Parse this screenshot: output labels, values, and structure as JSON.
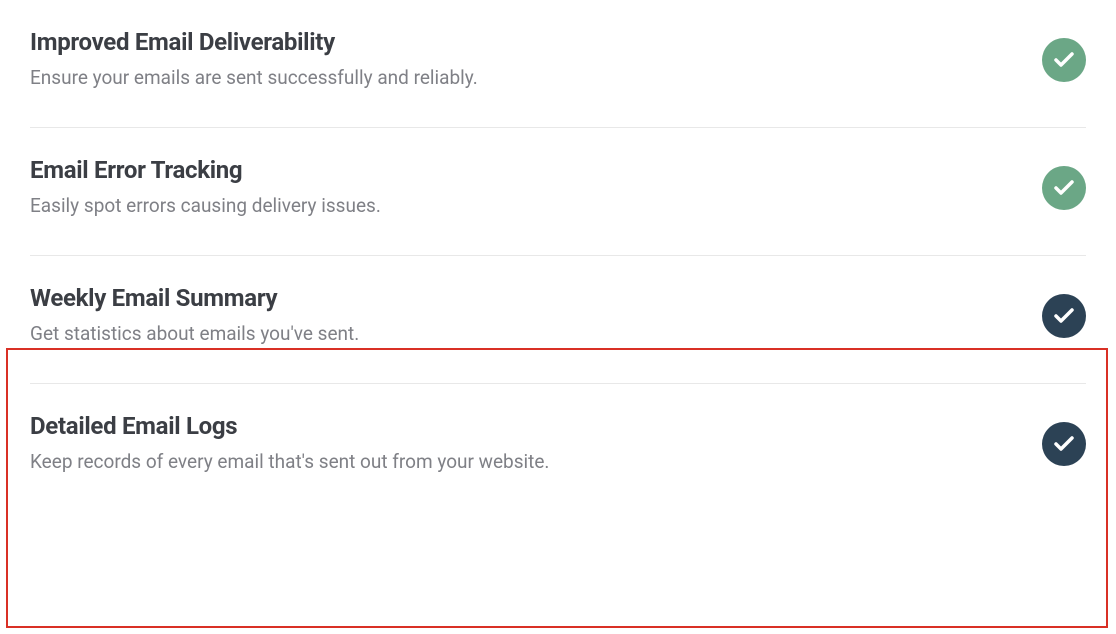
{
  "features": [
    {
      "title": "Improved Email Deliverability",
      "description": "Ensure your emails are sent successfully and reliably.",
      "badge_color": "green"
    },
    {
      "title": "Email Error Tracking",
      "description": "Easily spot errors causing delivery issues.",
      "badge_color": "green"
    },
    {
      "title": "Weekly Email Summary",
      "description": "Get statistics about emails you've sent.",
      "badge_color": "dark"
    },
    {
      "title": "Detailed Email Logs",
      "description": "Keep records of every email that's sent out from your website.",
      "badge_color": "dark"
    }
  ]
}
